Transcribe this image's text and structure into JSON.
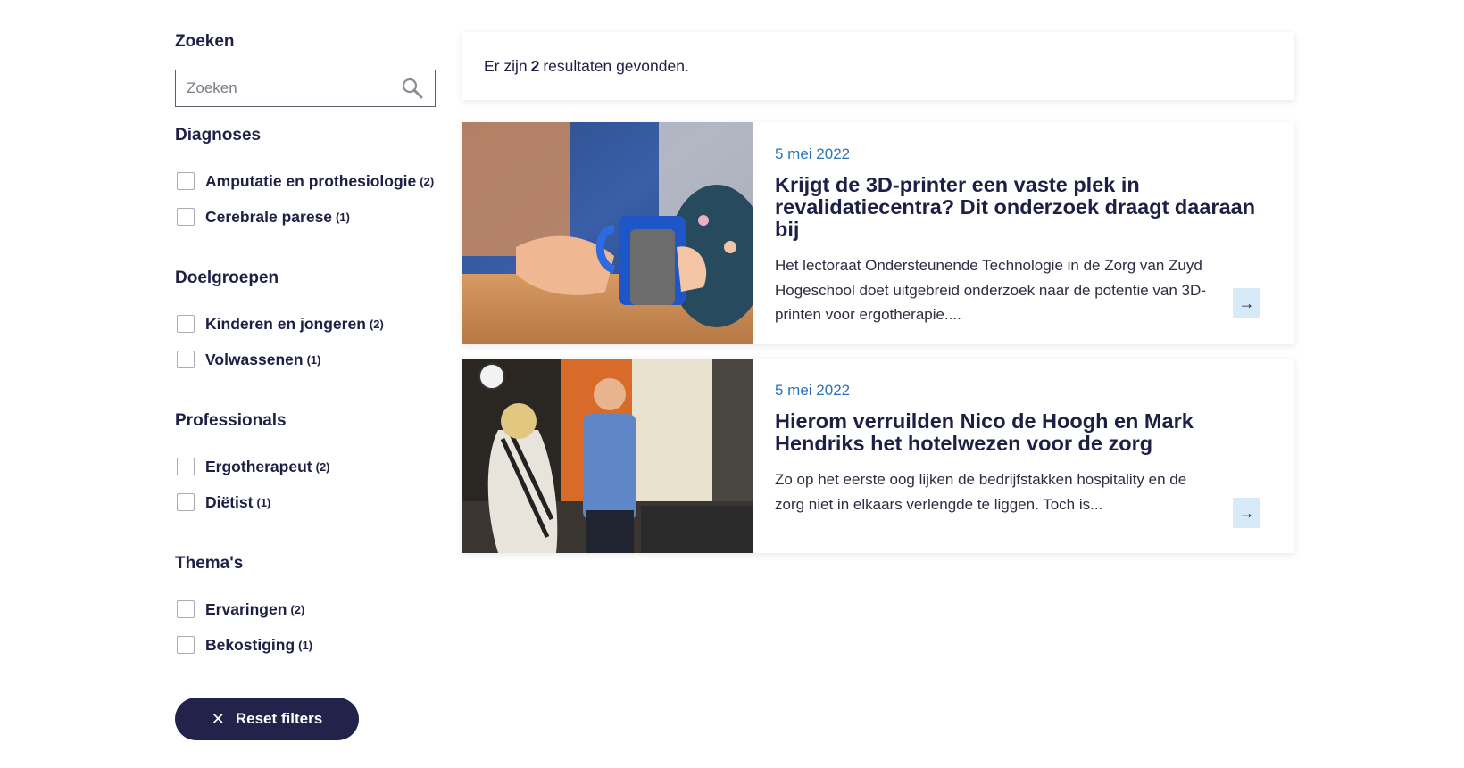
{
  "sidebar": {
    "search": {
      "title": "Zoeken",
      "placeholder": "Zoeken"
    },
    "groups": [
      {
        "title": "Diagnoses",
        "options": [
          {
            "label": "Amputatie en prothesiologie",
            "count": "(2)"
          },
          {
            "label": "Cerebrale parese",
            "count": "(1)"
          }
        ]
      },
      {
        "title": "Doelgroepen",
        "options": [
          {
            "label": "Kinderen en jongeren",
            "count": "(2)"
          },
          {
            "label": "Volwassenen",
            "count": "(1)"
          }
        ]
      },
      {
        "title": "Professionals",
        "options": [
          {
            "label": "Ergotherapeut",
            "count": "(2)"
          },
          {
            "label": "Diëtist",
            "count": "(1)"
          }
        ]
      },
      {
        "title": "Thema's",
        "options": [
          {
            "label": "Ervaringen",
            "count": "(2)"
          },
          {
            "label": "Bekostiging",
            "count": "(1)"
          }
        ]
      }
    ],
    "reset_label": "Reset filters"
  },
  "results": {
    "prefix": "Er zijn",
    "count": "2",
    "suffix": "resultaten gevonden."
  },
  "articles": [
    {
      "date": "5 mei 2022",
      "title": "Krijgt de 3D-printer een vaste plek in revalidatiecentra? Dit onderzoek draagt daaraan bij",
      "text": "Het lectoraat Ondersteunende Technologie in de Zorg van Zuyd Hogeschool doet uitgebreid onderzoek naar de potentie van 3D-printen voor ergotherapie....",
      "arrow_icon": "arrow-right-icon"
    },
    {
      "date": "5 mei 2022",
      "title": "Hierom verruilden Nico de Hoogh en Mark Hendriks het hotelwezen voor de zorg",
      "text": "Zo op het eerste oog lijken de bedrijfstakken hospitality en de zorg niet in elkaars verlengde te liggen. Toch is...",
      "arrow_icon": "arrow-right-icon"
    }
  ],
  "colors": {
    "navy": "#1e1f45",
    "date_blue": "#2a73b8",
    "arrow_bg": "#d6ebf7",
    "button_bg": "#22234a"
  }
}
